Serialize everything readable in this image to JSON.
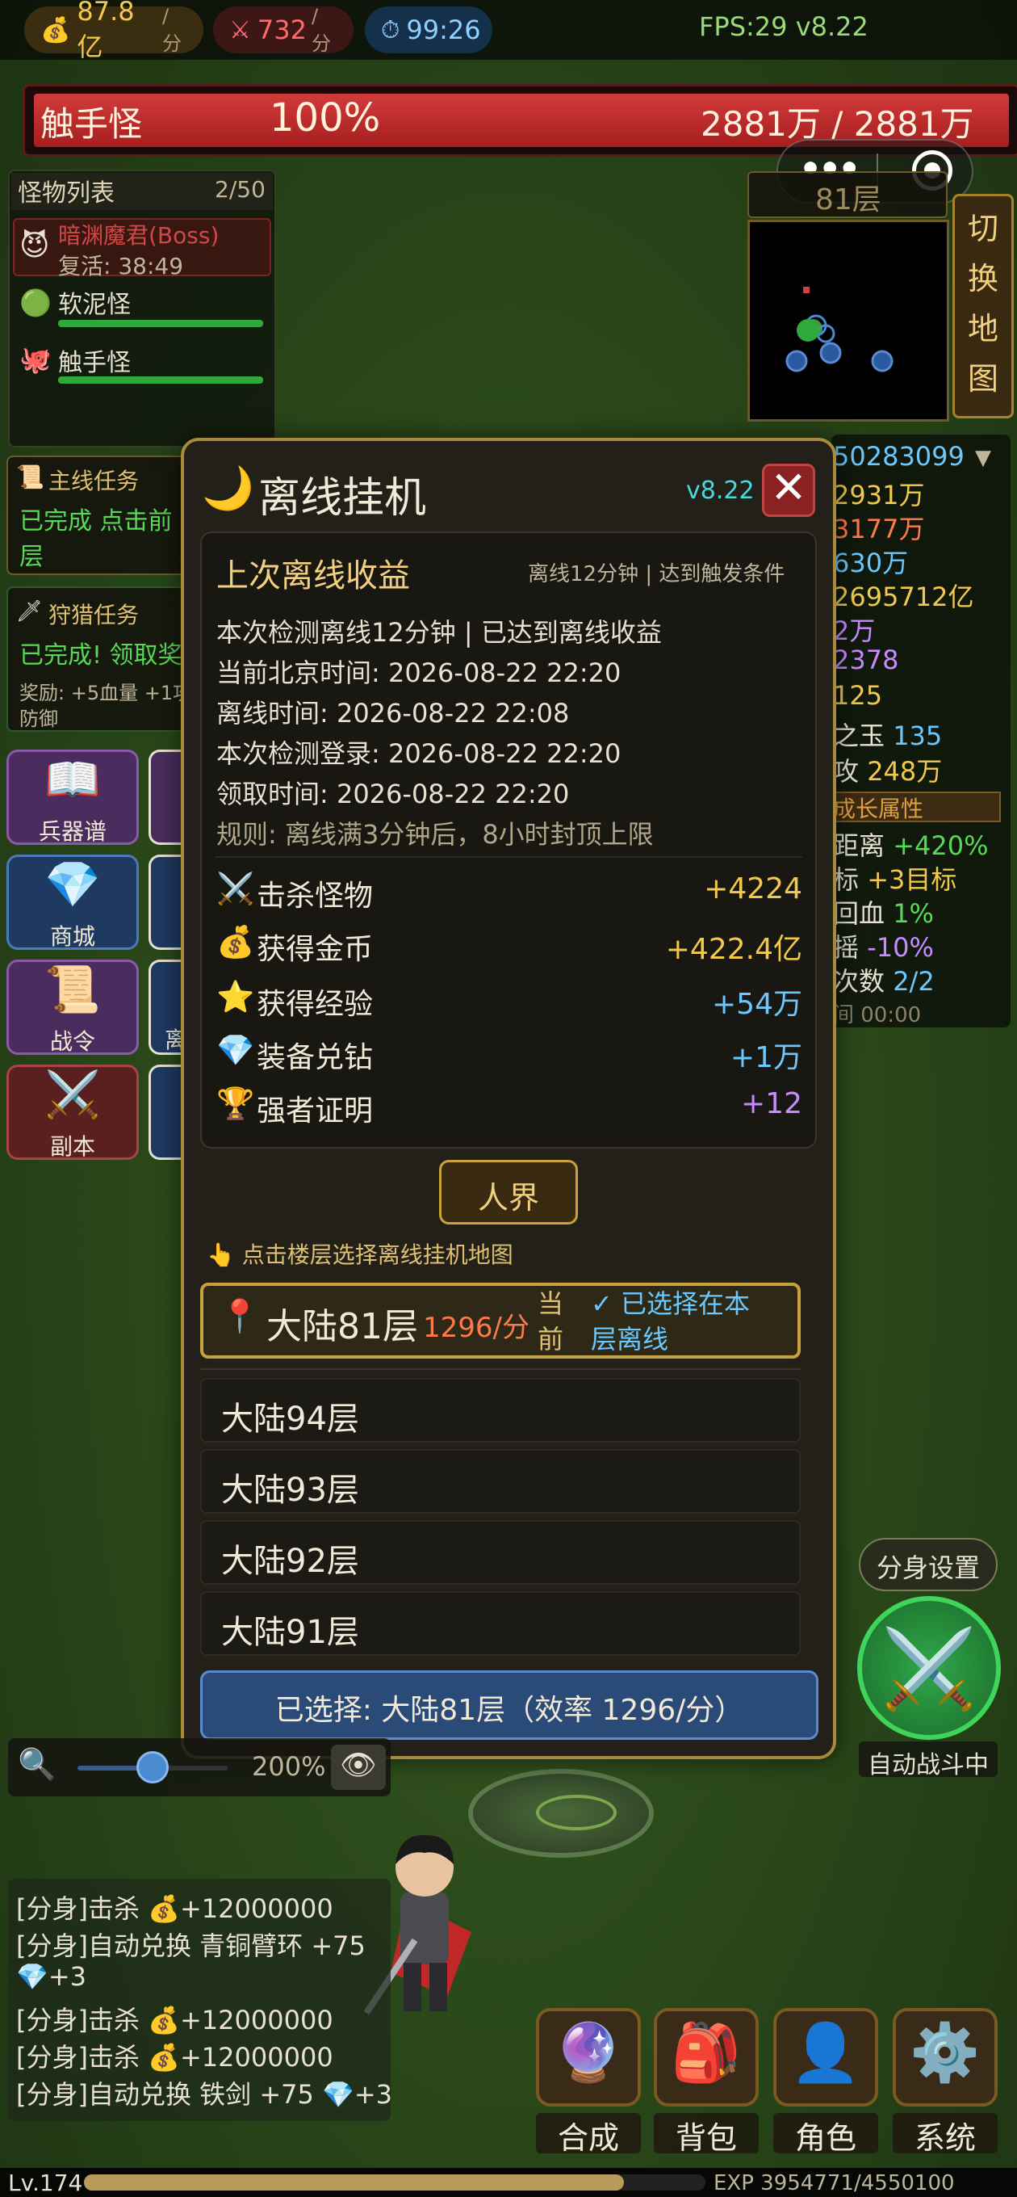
{
  "topbar": {
    "gold": "87.8亿",
    "gold_unit": "/分",
    "atk": "732",
    "atk_unit": "/分",
    "timer": "99:26",
    "fps": "FPS:29 v8.22"
  },
  "boss_bar": {
    "name": "触手怪",
    "percent": "100%",
    "hp": "2881万 / 2881万",
    "hp_fraction": 1.0
  },
  "monster_list": {
    "title": "怪物列表",
    "count": "2/50",
    "boss": {
      "name": "暗渊魔君(Boss)",
      "revive": "复活: 38:49"
    },
    "items": [
      {
        "name": "软泥怪",
        "hp_fraction": 1.0
      },
      {
        "name": "触手怪",
        "hp_fraction": 1.0
      }
    ]
  },
  "quests": {
    "main": {
      "title": "主线任务",
      "line1": "已完成 点击前",
      "line2": "层"
    },
    "hunt": {
      "title": "狩猎任务",
      "line1": "已完成! 领取奖",
      "line2": "奖励: +5血量 +1攻",
      "line3": "防御"
    }
  },
  "menu": [
    {
      "label": "兵器谱"
    },
    {
      "label": "商城"
    },
    {
      "label": "战令"
    },
    {
      "label": "副本"
    }
  ],
  "menu_partial": {
    "third": "离"
  },
  "map": {
    "floor": "81层",
    "switch_label": "切换地图"
  },
  "right_stats": {
    "s1": "50283099",
    "s2": "2931万",
    "s3": "3177万",
    "s4": "630万",
    "s5": "2695712亿",
    "s6": "2万",
    "s7": "2378",
    "s8": "125",
    "s9": "之玉",
    "s9v": "135",
    "s10": "攻",
    "s10v": "248万",
    "growth": "成长属性",
    "g1": "距离",
    "g1v": "+420%",
    "g2": "标",
    "g2v": "+3目标",
    "g3": "回血",
    "g3v": "1%",
    "g4": "摇",
    "g4v": "-10%",
    "g5": "次数",
    "g5v": "2/2",
    "g6": "间 00:00"
  },
  "modal": {
    "title": "离线挂机",
    "version": "v8.22",
    "close": "✕",
    "reward_title": "上次离线收益",
    "reward_sub": "离线12分钟 | 达到触发条件",
    "info": [
      "本次检测离线12分钟 | 已达到离线收益",
      "当前北京时间: 2026-08-22 22:20",
      "离线时间: 2026-08-22 22:08",
      "本次检测登录: 2026-08-22 22:20",
      "领取时间: 2026-08-22 22:20"
    ],
    "rule": "规则: 离线满3分钟后，8小时封顶上限",
    "rewards": [
      {
        "icon": "⚔️",
        "label": "击杀怪物",
        "value": "+4224",
        "color": "#f2c94c"
      },
      {
        "icon": "💰",
        "label": "获得金币",
        "value": "+422.4亿",
        "color": "#f2c94c"
      },
      {
        "icon": "⭐",
        "label": "获得经验",
        "value": "+54万",
        "color": "#6ac8ff"
      },
      {
        "icon": "💎",
        "label": "装备兑钻",
        "value": "+1万",
        "color": "#6ac8ff"
      },
      {
        "icon": "🏆",
        "label": "强者证明",
        "value": "+12",
        "color": "#c88aff"
      }
    ],
    "realm": "人界",
    "hint": "点击楼层选择离线挂机地图",
    "selected_floor": {
      "name": "大陆81层",
      "rate": "1296/分",
      "current": "当前",
      "status": "✓ 已选择在本层离线"
    },
    "floors": [
      "大陆94层",
      "大陆93层",
      "大陆92层",
      "大陆91层"
    ],
    "confirm": "已选择: 大陆81层（效率 1296/分）"
  },
  "battle": {
    "clone_settings": "分身设置",
    "auto": "自动战斗中"
  },
  "zoom": {
    "value": "200%",
    "level": 0.5
  },
  "log": [
    "[分身]击杀 💰+12000000",
    "[分身]自动兑换 青铜臂环 +75",
    "💎+3",
    "[分身]击杀 💰+12000000",
    "[分身]击杀 💰+12000000",
    "[分身]自动兑换 铁剑 +75 💎+3"
  ],
  "bottom_buttons": [
    {
      "label": "合成",
      "icon": "🔮"
    },
    {
      "label": "背包",
      "icon": "🎒"
    },
    {
      "label": "角色",
      "icon": "👤"
    },
    {
      "label": "系统",
      "icon": "⚙️"
    }
  ],
  "exp": {
    "level": "Lv.174",
    "text": "EXP 3954771/4550100 (86.9%)",
    "fraction": 0.869
  }
}
